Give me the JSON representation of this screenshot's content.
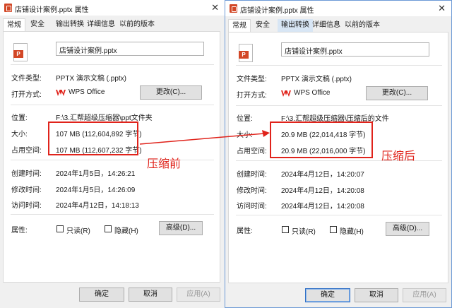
{
  "left": {
    "title": "店铺设计案例.pptx 属性",
    "tabs": [
      "常规",
      "安全",
      "输出转换",
      "详细信息",
      "以前的版本"
    ],
    "filename": "店铺设计案例.pptx",
    "file_type_label": "文件类型:",
    "file_type_value": "PPTX 演示文稿 (.pptx)",
    "open_with_label": "打开方式:",
    "open_with_value": "WPS Office",
    "change_button": "更改(C)...",
    "location_label": "位置:",
    "location_value": "F:\\3.汇帮超级压缩器\\ppt文件夹",
    "size_label": "大小:",
    "size_value": "107 MB (112,604,892 字节)",
    "disk_label": "占用空间:",
    "disk_value": "107 MB (112,607,232 字节)",
    "created_label": "创建时间:",
    "created_value": "2024年1月5日，14:26:21",
    "modified_label": "修改时间:",
    "modified_value": "2024年1月5日，14:26:09",
    "accessed_label": "访问时间:",
    "accessed_value": "2024年4月12日，14:18:13",
    "attr_label": "属性:",
    "readonly_label": "只读(R)",
    "hidden_label": "隐藏(H)",
    "advanced_button": "高级(D)...",
    "ok_button": "确定",
    "cancel_button": "取消",
    "apply_button": "应用(A)"
  },
  "right": {
    "title": "店铺设计案例.pptx 属性",
    "tabs": [
      "常规",
      "安全",
      "输出转换",
      "详细信息",
      "以前的版本"
    ],
    "filename": "店铺设计案例.pptx",
    "file_type_label": "文件类型:",
    "file_type_value": "PPTX 演示文稿 (.pptx)",
    "open_with_label": "打开方式:",
    "open_with_value": "WPS Office",
    "change_button": "更改(C)...",
    "location_label": "位置:",
    "location_value": "F:\\3.汇帮超级压缩器\\压缩后的文件",
    "size_label": "大小:",
    "size_value": "20.9 MB (22,014,418 字节)",
    "disk_label": "占用空间:",
    "disk_value": "20.9 MB (22,016,000 字节)",
    "created_label": "创建时间:",
    "created_value": "2024年4月12日，14:20:07",
    "modified_label": "修改时间:",
    "modified_value": "2024年4月12日，14:20:08",
    "accessed_label": "访问时间:",
    "accessed_value": "2024年4月12日，14:20:08",
    "attr_label": "属性:",
    "readonly_label": "只读(R)",
    "hidden_label": "隐藏(H)",
    "advanced_button": "高级(D)...",
    "ok_button": "确定",
    "cancel_button": "取消",
    "apply_button": "应用(A)"
  },
  "annotations": {
    "before": "压缩前",
    "after": "压缩后",
    "color": "#e0231b"
  },
  "icons": {
    "file": "pptx-file-icon",
    "app": "wps-office-icon",
    "close": "close-icon"
  }
}
